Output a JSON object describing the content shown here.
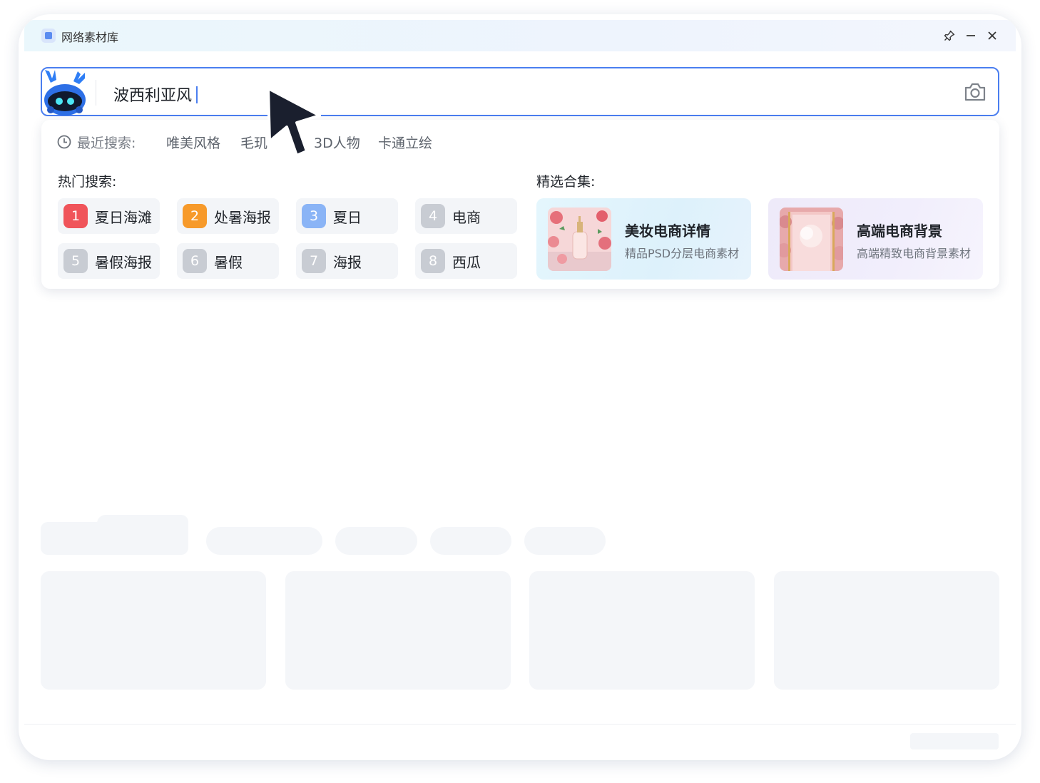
{
  "window": {
    "title": "网络素材库",
    "buttons": {
      "pin": "pin-icon",
      "minimize": "minimize-icon",
      "close": "close-icon"
    }
  },
  "search": {
    "query": "波西利亚风",
    "camera": "camera-icon"
  },
  "recent": {
    "label": "最近搜索:",
    "items": [
      "唯美风格",
      "毛玑",
      "3D人物",
      "卡通立绘"
    ]
  },
  "hot": {
    "title": "热门搜索:",
    "items": [
      {
        "rank": "1",
        "label": "夏日海滩",
        "color": "#f0545a"
      },
      {
        "rank": "2",
        "label": "处暑海报",
        "color": "#f79a2a"
      },
      {
        "rank": "3",
        "label": "夏日",
        "color": "#8ab4f6"
      },
      {
        "rank": "4",
        "label": "电商",
        "color": "#c8ccd3"
      },
      {
        "rank": "5",
        "label": "暑假海报",
        "color": "#c8ccd3"
      },
      {
        "rank": "6",
        "label": "暑假",
        "color": "#c8ccd3"
      },
      {
        "rank": "7",
        "label": "海报",
        "color": "#c8ccd3"
      },
      {
        "rank": "8",
        "label": "西瓜",
        "color": "#c8ccd3"
      }
    ]
  },
  "featured": {
    "title": "精选合集:",
    "items": [
      {
        "title": "美妆电商详情",
        "subtitle": "精品PSD分层电商素材"
      },
      {
        "title": "高端电商背景",
        "subtitle": "高端精致电商背景素材"
      }
    ]
  },
  "colors": {
    "accent": "#4a7ef0"
  }
}
